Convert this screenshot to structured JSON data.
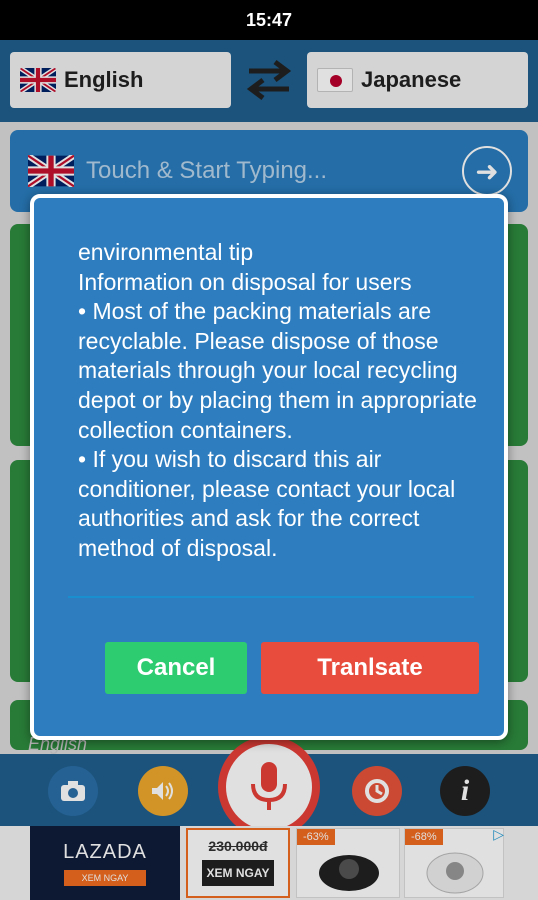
{
  "status_bar": {
    "time": "15:47"
  },
  "language_bar": {
    "source_language": "English",
    "target_language": "Japanese"
  },
  "input": {
    "placeholder": "Touch & Start Typing..."
  },
  "behind_label": "English",
  "dialog": {
    "text": "environmental tip\nInformation on disposal for users\n• Most of the packing materials are recyclable. Please dispose of those materials through your local recycling depot or by placing them in appropriate collection containers.\n• If you wish to discard this air conditioner, please contact your local authorities and ask for the correct method of disposal.",
    "cancel_label": "Cancel",
    "translate_label": "Tranlsate"
  },
  "ad": {
    "brand": "LAZADA",
    "cta": "XEM NGAY",
    "price": "230.000đ",
    "xem_label": "XEM NGAY",
    "discount_1": "-63%",
    "discount_2": "-68%"
  },
  "icons": [
    "camera-icon",
    "speaker-icon",
    "microphone-icon",
    "history-icon",
    "info-icon",
    "swap-icon",
    "arrow-right-icon"
  ],
  "colors": {
    "primary_blue": "#2e7dbf",
    "cancel_green": "#2ecc71",
    "translate_red": "#e74c3c",
    "header_blue": "#1f5f8e"
  }
}
